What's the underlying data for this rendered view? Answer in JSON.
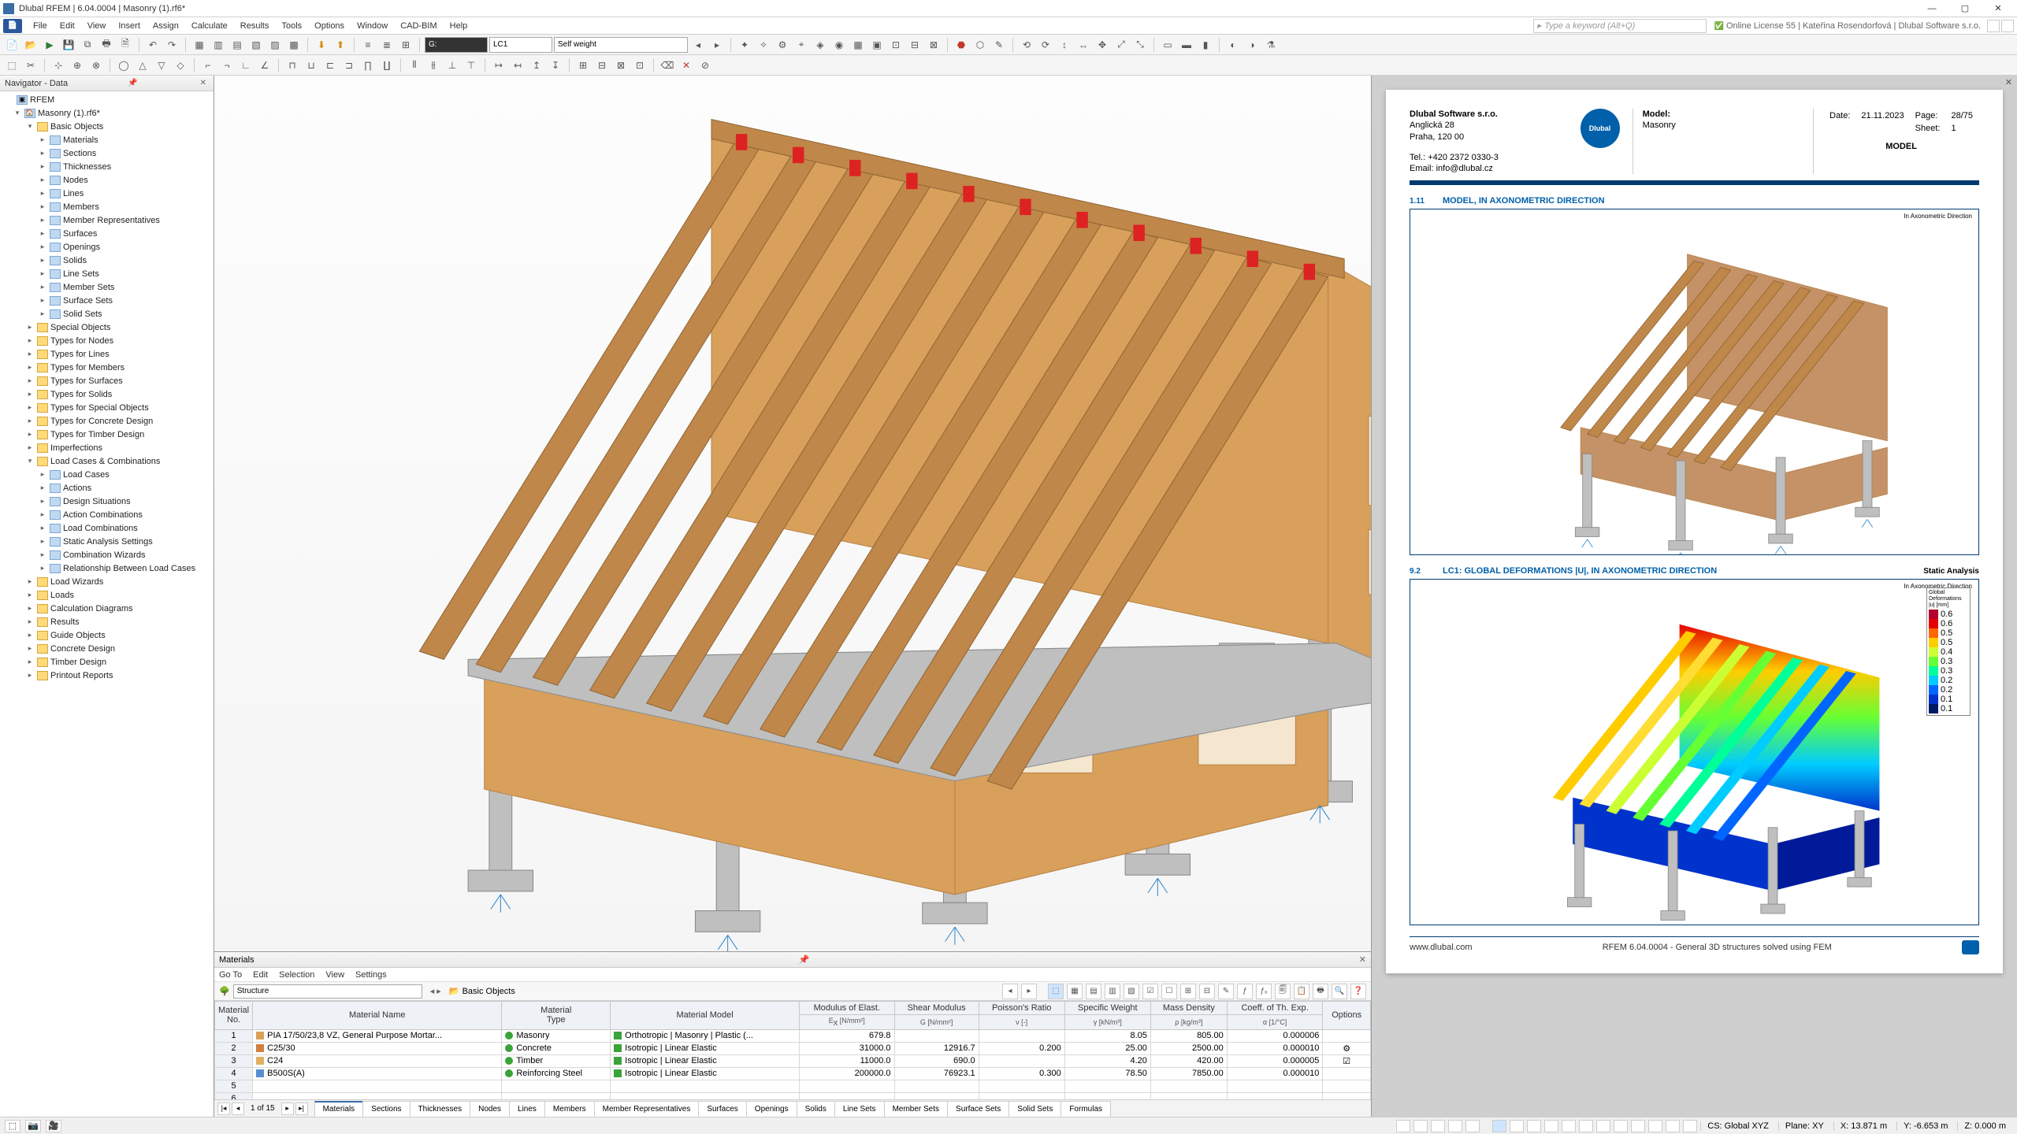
{
  "app": {
    "title": "Dlubal RFEM | 6.04.0004 | Masonry (1).rf6*",
    "search_placeholder": "Type a keyword (Alt+Q)",
    "license": "Online License 55 | Kateřina Rosendorfová | Dlubal Software s.r.o."
  },
  "menu": [
    "File",
    "Edit",
    "View",
    "Insert",
    "Assign",
    "Calculate",
    "Results",
    "Tools",
    "Options",
    "Window",
    "CAD-BIM",
    "Help"
  ],
  "load_combo": {
    "code": "LC1",
    "name": "Self weight"
  },
  "navigator": {
    "title": "Navigator - Data",
    "root": "RFEM",
    "model": "Masonry (1).rf6*",
    "groups": [
      {
        "label": "Basic Objects",
        "expanded": true,
        "children": [
          "Materials",
          "Sections",
          "Thicknesses",
          "Nodes",
          "Lines",
          "Members",
          "Member Representatives",
          "Surfaces",
          "Openings",
          "Solids",
          "Line Sets",
          "Member Sets",
          "Surface Sets",
          "Solid Sets"
        ]
      },
      {
        "label": "Special Objects"
      },
      {
        "label": "Types for Nodes"
      },
      {
        "label": "Types for Lines"
      },
      {
        "label": "Types for Members"
      },
      {
        "label": "Types for Surfaces"
      },
      {
        "label": "Types for Solids"
      },
      {
        "label": "Types for Special Objects"
      },
      {
        "label": "Types for Concrete Design"
      },
      {
        "label": "Types for Timber Design"
      },
      {
        "label": "Imperfections"
      },
      {
        "label": "Load Cases & Combinations",
        "expanded": true,
        "children": [
          "Load Cases",
          "Actions",
          "Design Situations",
          "Action Combinations",
          "Load Combinations",
          "Static Analysis Settings",
          "Combination Wizards",
          "Relationship Between Load Cases"
        ]
      },
      {
        "label": "Load Wizards"
      },
      {
        "label": "Loads"
      },
      {
        "label": "Calculation Diagrams"
      },
      {
        "label": "Results"
      },
      {
        "label": "Guide Objects"
      },
      {
        "label": "Concrete Design"
      },
      {
        "label": "Timber Design"
      },
      {
        "label": "Printout Reports"
      }
    ]
  },
  "materials_panel": {
    "title": "Materials",
    "menu": [
      "Go To",
      "Edit",
      "Selection",
      "View",
      "Settings"
    ],
    "structure_combo": "Structure",
    "breadcrumb": "Basic Objects",
    "headers": {
      "no": "Material\nNo.",
      "name": "Material Name",
      "type": "Material\nType",
      "model": "Material Model",
      "mod": "Modulus of Elast.\nEₓ [N/mm²]",
      "shear": "Shear Modulus\nG [N/mm²]",
      "poisson": "Poisson's Ratio\nν [-]",
      "weight": "Specific Weight\nγ [kN/m³]",
      "density": "Mass Density\nρ [kg/m³]",
      "therm": "Coeff. of Th. Exp.\nα [1/°C]",
      "options": "Options"
    },
    "rows": [
      {
        "no": 1,
        "swatch": "#d9a05b",
        "name": "PIA 17/50/23,8 VZ, General Purpose Mortar...",
        "type": "Masonry",
        "tsw": "#3aa33a",
        "model": "Orthotropic | Masonry | Plastic (...",
        "E": "679.8",
        "G": "",
        "nu": "",
        "gamma": "8.05",
        "rho": "805.00",
        "alpha": "0.000006",
        "opt": ""
      },
      {
        "no": 2,
        "swatch": "#d08040",
        "name": "C25/30",
        "type": "Concrete",
        "tsw": "#3aa33a",
        "model": "Isotropic | Linear Elastic",
        "E": "31000.0",
        "G": "12916.7",
        "nu": "0.200",
        "gamma": "25.00",
        "rho": "2500.00",
        "alpha": "0.000010",
        "opt": "⚙"
      },
      {
        "no": 3,
        "swatch": "#e0b060",
        "name": "C24",
        "type": "Timber",
        "tsw": "#3aa33a",
        "model": "Isotropic | Linear Elastic",
        "E": "11000.0",
        "G": "690.0",
        "nu": "",
        "gamma": "4.20",
        "rho": "420.00",
        "alpha": "0.000005",
        "opt": "☑"
      },
      {
        "no": 4,
        "swatch": "#5a8ed0",
        "name": "B500S(A)",
        "type": "Reinforcing Steel",
        "tsw": "#3aa33a",
        "model": "Isotropic | Linear Elastic",
        "E": "200000.0",
        "G": "76923.1",
        "nu": "0.300",
        "gamma": "78.50",
        "rho": "7850.00",
        "alpha": "0.000010",
        "opt": ""
      }
    ],
    "page_info": "1 of 15",
    "tabs": [
      "Materials",
      "Sections",
      "Thicknesses",
      "Nodes",
      "Lines",
      "Members",
      "Member Representatives",
      "Surfaces",
      "Openings",
      "Solids",
      "Line Sets",
      "Member Sets",
      "Surface Sets",
      "Solid Sets",
      "Formulas"
    ]
  },
  "report": {
    "company": "Dlubal Software s.r.o.",
    "addr1": "Anglická 28",
    "addr2": "Praha, 120 00",
    "tel": "Tel.: +420 2372 0330-3",
    "email": "Email: info@dlubal.cz",
    "model_label": "Model:",
    "model_value": "Masonry",
    "date_label": "Date:",
    "date_value": "21.11.2023",
    "page_label": "Page:",
    "page_value": "28/75",
    "sheet_label": "Sheet:",
    "sheet_value": "1",
    "model_big": "MODEL",
    "sect1": {
      "num": "1.11",
      "title": "MODEL, IN AXONOMETRIC DIRECTION",
      "corner": "In Axonometric Direction"
    },
    "sect2": {
      "num": "9.2",
      "title": "LC1: GLOBAL DEFORMATIONS |U|, IN AXONOMETRIC DIRECTION",
      "right": "Static Analysis",
      "corner": "In Axonometric Direction"
    },
    "legend": {
      "title": "Global\nDeformations\n|u| [mm]",
      "items": [
        {
          "c": "#b3002d",
          "v": "0.6"
        },
        {
          "c": "#e60000",
          "v": "0.6"
        },
        {
          "c": "#ff6600",
          "v": "0.5"
        },
        {
          "c": "#ffcc00",
          "v": "0.5"
        },
        {
          "c": "#ccff33",
          "v": "0.4"
        },
        {
          "c": "#66ff33",
          "v": "0.3"
        },
        {
          "c": "#00ff99",
          "v": "0.3"
        },
        {
          "c": "#00ccff",
          "v": "0.2"
        },
        {
          "c": "#0066ff",
          "v": "0.2"
        },
        {
          "c": "#0033cc",
          "v": "0.1"
        },
        {
          "c": "#001a66",
          "v": "0.1"
        }
      ]
    },
    "footer": {
      "site": "www.dlubal.com",
      "prog": "RFEM 6.04.0004 - General 3D structures solved using FEM"
    }
  },
  "status": {
    "cs": "CS: Global XYZ",
    "plane": "Plane: XY",
    "x": "X: 13.871 m",
    "y": "Y: -6.653 m",
    "z": "Z: 0.000 m"
  }
}
